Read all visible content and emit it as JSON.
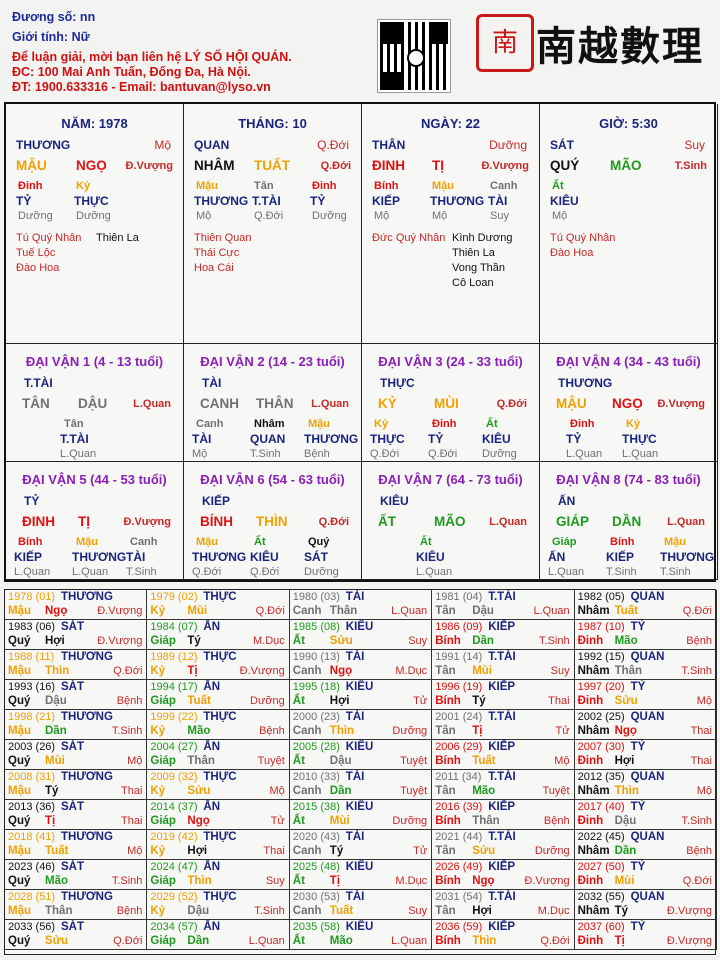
{
  "header": {
    "line1": "Đương số: nn",
    "line2": "Giới tính:  Nữ",
    "line3": "Để luận giải, mời bạn liên hệ LÝ SỐ HỘI QUÁN.",
    "line4": "ĐC: 100 Mai Anh Tuấn, Đống Đa, Hà Nội.",
    "line5": "ĐT: 1900.633316 - Email: bantuvan@lyso.vn",
    "seal_text": "南",
    "brand_text": "南越數理"
  },
  "pillars": [
    {
      "title": "NĂM: 1978",
      "god_left": "THƯƠNG",
      "god_right": "Mộ",
      "stem": "MẬU",
      "branch": "NGỌ",
      "status": "Đ.Vượng",
      "hidden": [
        "Đinh",
        "Kỷ"
      ],
      "hidden_gods": [
        "TỶ",
        "THỰC"
      ],
      "hidden_status": [
        "Dưỡng",
        "Dưỡng"
      ],
      "stars_left": [
        "Tú Quý Nhân",
        "Tuế Lộc",
        "Đào Hoa"
      ],
      "stars_right": [
        "Thiên La"
      ]
    },
    {
      "title": "THÁNG: 10",
      "god_left": "QUAN",
      "god_right": "Q.Đới",
      "stem": "NHÂM",
      "branch": "TUẤT",
      "status": "Q.Đới",
      "hidden": [
        "Mậu",
        "Tân",
        "Đinh"
      ],
      "hidden_gods": [
        "THƯƠNG",
        "T.TÀI",
        "TỶ"
      ],
      "hidden_status": [
        "Mộ",
        "Q.Đới",
        "Dưỡng"
      ],
      "stars_left": [
        "Thiên Quan",
        "Thái Cực",
        "Hoa Cái"
      ],
      "stars_right": []
    },
    {
      "title": "NGÀY: 22",
      "god_left": "THÂN",
      "god_right": "Dưỡng",
      "stem": "ĐINH",
      "branch": "TỊ",
      "status": "Đ.Vượng",
      "hidden": [
        "Bính",
        "Mậu",
        "Canh"
      ],
      "hidden_gods": [
        "KIẾP",
        "THƯƠNG",
        "TÀI"
      ],
      "hidden_status": [
        "Mộ",
        "Mộ",
        "Suy"
      ],
      "stars_left": [
        "Đức Quý Nhân"
      ],
      "stars_right": [
        "Kình Dương",
        "Thiên La",
        "Vong Thần",
        "Cô Loan"
      ]
    },
    {
      "title": "GIỜ: 5:30",
      "god_left": "SÁT",
      "god_right": "Suy",
      "stem": "QUÝ",
      "branch": "MÃO",
      "status": "T.Sinh",
      "hidden": [
        "Ất"
      ],
      "hidden_gods": [
        "KIÊU"
      ],
      "hidden_status": [
        "Mộ"
      ],
      "stars_left": [
        "Tú Quý Nhân",
        "Đào Hoa"
      ],
      "stars_right": []
    }
  ],
  "dai_van": [
    {
      "title": "ĐẠI VẬN 1 (4 - 13 tuổi)",
      "god": "T.TÀI",
      "stem": "TÂN",
      "branch": "DẬU",
      "status": "L.Quan",
      "hidden": [
        "Tân"
      ],
      "hidden_gods": [
        "T.TÀI"
      ],
      "hidden_status": [
        "L.Quan"
      ]
    },
    {
      "title": "ĐẠI VẬN 2 (14 - 23 tuổi)",
      "god": "TÀI",
      "stem": "CANH",
      "branch": "THÂN",
      "status": "L.Quan",
      "hidden": [
        "Canh",
        "Nhâm",
        "Mậu"
      ],
      "hidden_gods": [
        "TÀI",
        "QUAN",
        "THƯƠNG"
      ],
      "hidden_status": [
        "Mộ",
        "T.Sinh",
        "Bệnh"
      ]
    },
    {
      "title": "ĐẠI VẬN 3 (24 - 33 tuổi)",
      "god": "THỰC",
      "stem": "KỶ",
      "branch": "MÙI",
      "status": "Q.Đới",
      "hidden": [
        "Kỷ",
        "Đinh",
        "Ất"
      ],
      "hidden_gods": [
        "THỰC",
        "TỶ",
        "KIÊU"
      ],
      "hidden_status": [
        "Q.Đới",
        "Q.Đới",
        "Dưỡng"
      ]
    },
    {
      "title": "ĐẠI VẬN 4 (34 - 43 tuổi)",
      "god": "THƯƠNG",
      "stem": "MẬU",
      "branch": "NGỌ",
      "status": "Đ.Vượng",
      "hidden": [
        "Đinh",
        "Kỷ"
      ],
      "hidden_gods": [
        "TỶ",
        "THỰC"
      ],
      "hidden_status": [
        "L.Quan",
        "L.Quan"
      ]
    },
    {
      "title": "ĐẠI VẬN 5 (44 - 53 tuổi)",
      "god": "TỶ",
      "stem": "ĐINH",
      "branch": "TỊ",
      "status": "Đ.Vượng",
      "hidden": [
        "Bính",
        "Mậu",
        "Canh"
      ],
      "hidden_gods": [
        "KIẾP",
        "THƯƠNG",
        "TÀI"
      ],
      "hidden_status": [
        "L.Quan",
        "L.Quan",
        "T.Sinh"
      ]
    },
    {
      "title": "ĐẠI VẬN 6 (54 - 63 tuổi)",
      "god": "KIẾP",
      "stem": "BÍNH",
      "branch": "THÌN",
      "status": "Q.Đới",
      "hidden": [
        "Mậu",
        "Ất",
        "Quý"
      ],
      "hidden_gods": [
        "THƯƠNG",
        "KIÊU",
        "SÁT"
      ],
      "hidden_status": [
        "Q.Đới",
        "Q.Đới",
        "Dưỡng"
      ]
    },
    {
      "title": "ĐẠI VẬN 7 (64 - 73 tuổi)",
      "god": "KIÊU",
      "stem": "ẤT",
      "branch": "MÃO",
      "status": "L.Quan",
      "hidden": [
        "Ất"
      ],
      "hidden_gods": [
        "KIÊU"
      ],
      "hidden_status": [
        "L.Quan"
      ]
    },
    {
      "title": "ĐẠI VẬN 8 (74 - 83 tuổi)",
      "god": "ẤN",
      "stem": "GIÁP",
      "branch": "DẦN",
      "status": "L.Quan",
      "hidden": [
        "Giáp",
        "Bính",
        "Mậu"
      ],
      "hidden_gods": [
        "ẤN",
        "KIẾP",
        "THƯƠNG"
      ],
      "hidden_status": [
        "L.Quan",
        "T.Sinh",
        "T.Sinh"
      ]
    }
  ],
  "years": [
    {
      "head": "1978 (01)",
      "god": "THƯƠNG",
      "stem": "Mậu",
      "branch": "Ngọ",
      "status": "Đ.Vượng"
    },
    {
      "head": "1979 (02)",
      "god": "THỰC",
      "stem": "Kỷ",
      "branch": "Mùi",
      "status": "Q.Đới"
    },
    {
      "head": "1980 (03)",
      "god": "TÀI",
      "stem": "Canh",
      "branch": "Thân",
      "status": "L.Quan"
    },
    {
      "head": "1981 (04)",
      "god": "T.TÀI",
      "stem": "Tân",
      "branch": "Dậu",
      "status": "L.Quan"
    },
    {
      "head": "1982 (05)",
      "god": "QUAN",
      "stem": "Nhâm",
      "branch": "Tuất",
      "status": "Q.Đới"
    },
    {
      "head": "1983 (06)",
      "god": "SÁT",
      "stem": "Quý",
      "branch": "Hợi",
      "status": "Đ.Vượng"
    },
    {
      "head": "1984 (07)",
      "god": "ẤN",
      "stem": "Giáp",
      "branch": "Tý",
      "status": "M.Dục"
    },
    {
      "head": "1985 (08)",
      "god": "KIÊU",
      "stem": "Ất",
      "branch": "Sửu",
      "status": "Suy"
    },
    {
      "head": "1986 (09)",
      "god": "KIẾP",
      "stem": "Bính",
      "branch": "Dần",
      "status": "T.Sinh"
    },
    {
      "head": "1987 (10)",
      "god": "TỶ",
      "stem": "Đinh",
      "branch": "Mão",
      "status": "Bệnh"
    },
    {
      "head": "1988 (11)",
      "god": "THƯƠNG",
      "stem": "Mậu",
      "branch": "Thìn",
      "status": "Q.Đới"
    },
    {
      "head": "1989 (12)",
      "god": "THỰC",
      "stem": "Kỷ",
      "branch": "Tị",
      "status": "Đ.Vượng"
    },
    {
      "head": "1990 (13)",
      "god": "TÀI",
      "stem": "Canh",
      "branch": "Ngọ",
      "status": "M.Dục"
    },
    {
      "head": "1991 (14)",
      "god": "T.TÀI",
      "stem": "Tân",
      "branch": "Mùi",
      "status": "Suy"
    },
    {
      "head": "1992 (15)",
      "god": "QUAN",
      "stem": "Nhâm",
      "branch": "Thân",
      "status": "T.Sinh"
    },
    {
      "head": "1993 (16)",
      "god": "SÁT",
      "stem": "Quý",
      "branch": "Dậu",
      "status": "Bệnh"
    },
    {
      "head": "1994 (17)",
      "god": "ẤN",
      "stem": "Giáp",
      "branch": "Tuất",
      "status": "Dưỡng"
    },
    {
      "head": "1995 (18)",
      "god": "KIÊU",
      "stem": "Ất",
      "branch": "Hợi",
      "status": "Tử"
    },
    {
      "head": "1996 (19)",
      "god": "KIẾP",
      "stem": "Bính",
      "branch": "Tý",
      "status": "Thai"
    },
    {
      "head": "1997 (20)",
      "god": "TỶ",
      "stem": "Đinh",
      "branch": "Sửu",
      "status": "Mộ"
    },
    {
      "head": "1998 (21)",
      "god": "THƯƠNG",
      "stem": "Mậu",
      "branch": "Dần",
      "status": "T.Sinh"
    },
    {
      "head": "1999 (22)",
      "god": "THỰC",
      "stem": "Kỷ",
      "branch": "Mão",
      "status": "Bệnh"
    },
    {
      "head": "2000 (23)",
      "god": "TÀI",
      "stem": "Canh",
      "branch": "Thìn",
      "status": "Dưỡng"
    },
    {
      "head": "2001 (24)",
      "god": "T.TÀI",
      "stem": "Tân",
      "branch": "Tị",
      "status": "Tử"
    },
    {
      "head": "2002 (25)",
      "god": "QUAN",
      "stem": "Nhâm",
      "branch": "Ngọ",
      "status": "Thai"
    },
    {
      "head": "2003 (26)",
      "god": "SÁT",
      "stem": "Quý",
      "branch": "Mùi",
      "status": "Mộ"
    },
    {
      "head": "2004 (27)",
      "god": "ẤN",
      "stem": "Giáp",
      "branch": "Thân",
      "status": "Tuyệt"
    },
    {
      "head": "2005 (28)",
      "god": "KIÊU",
      "stem": "Ất",
      "branch": "Dậu",
      "status": "Tuyệt"
    },
    {
      "head": "2006 (29)",
      "god": "KIẾP",
      "stem": "Bính",
      "branch": "Tuất",
      "status": "Mộ"
    },
    {
      "head": "2007 (30)",
      "god": "TỶ",
      "stem": "Đinh",
      "branch": "Hợi",
      "status": "Thai"
    },
    {
      "head": "2008 (31)",
      "god": "THƯƠNG",
      "stem": "Mậu",
      "branch": "Tý",
      "status": "Thai"
    },
    {
      "head": "2009 (32)",
      "god": "THỰC",
      "stem": "Kỷ",
      "branch": "Sửu",
      "status": "Mộ"
    },
    {
      "head": "2010 (33)",
      "god": "TÀI",
      "stem": "Canh",
      "branch": "Dần",
      "status": "Tuyệt"
    },
    {
      "head": "2011 (34)",
      "god": "T.TÀI",
      "stem": "Tân",
      "branch": "Mão",
      "status": "Tuyệt"
    },
    {
      "head": "2012 (35)",
      "god": "QUAN",
      "stem": "Nhâm",
      "branch": "Thìn",
      "status": "Mộ"
    },
    {
      "head": "2013 (36)",
      "god": "SÁT",
      "stem": "Quý",
      "branch": "Tị",
      "status": "Thai"
    },
    {
      "head": "2014 (37)",
      "god": "ẤN",
      "stem": "Giáp",
      "branch": "Ngọ",
      "status": "Tử"
    },
    {
      "head": "2015 (38)",
      "god": "KIÊU",
      "stem": "Ất",
      "branch": "Mùi",
      "status": "Dưỡng"
    },
    {
      "head": "2016 (39)",
      "god": "KIẾP",
      "stem": "Bính",
      "branch": "Thân",
      "status": "Bệnh"
    },
    {
      "head": "2017 (40)",
      "god": "TỶ",
      "stem": "Đinh",
      "branch": "Dậu",
      "status": "T.Sinh"
    },
    {
      "head": "2018 (41)",
      "god": "THƯƠNG",
      "stem": "Mậu",
      "branch": "Tuất",
      "status": "Mộ"
    },
    {
      "head": "2019 (42)",
      "god": "THỰC",
      "stem": "Kỷ",
      "branch": "Hợi",
      "status": "Thai"
    },
    {
      "head": "2020 (43)",
      "god": "TÀI",
      "stem": "Canh",
      "branch": "Tý",
      "status": "Tử"
    },
    {
      "head": "2021 (44)",
      "god": "T.TÀI",
      "stem": "Tân",
      "branch": "Sửu",
      "status": "Dưỡng"
    },
    {
      "head": "2022 (45)",
      "god": "QUAN",
      "stem": "Nhâm",
      "branch": "Dần",
      "status": "Bệnh"
    },
    {
      "head": "2023 (46)",
      "god": "SÁT",
      "stem": "Quý",
      "branch": "Mão",
      "status": "T.Sinh"
    },
    {
      "head": "2024 (47)",
      "god": "ẤN",
      "stem": "Giáp",
      "branch": "Thìn",
      "status": "Suy"
    },
    {
      "head": "2025 (48)",
      "god": "KIÊU",
      "stem": "Ất",
      "branch": "Tị",
      "status": "M.Dục"
    },
    {
      "head": "2026 (49)",
      "god": "KIẾP",
      "stem": "Bính",
      "branch": "Ngọ",
      "status": "Đ.Vượng"
    },
    {
      "head": "2027 (50)",
      "god": "TỶ",
      "stem": "Đinh",
      "branch": "Mùi",
      "status": "Q.Đới"
    },
    {
      "head": "2028 (51)",
      "god": "THƯƠNG",
      "stem": "Mậu",
      "branch": "Thân",
      "status": "Bệnh"
    },
    {
      "head": "2029 (52)",
      "god": "THỰC",
      "stem": "Kỷ",
      "branch": "Dậu",
      "status": "T.Sinh"
    },
    {
      "head": "2030 (53)",
      "god": "TÀI",
      "stem": "Canh",
      "branch": "Tuất",
      "status": "Suy"
    },
    {
      "head": "2031 (54)",
      "god": "T.TÀI",
      "stem": "Tân",
      "branch": "Hợi",
      "status": "M.Dục"
    },
    {
      "head": "2032 (55)",
      "god": "QUAN",
      "stem": "Nhâm",
      "branch": "Tý",
      "status": "Đ.Vượng"
    },
    {
      "head": "2033 (56)",
      "god": "SÁT",
      "stem": "Quý",
      "branch": "Sửu",
      "status": "Q.Đới"
    },
    {
      "head": "2034 (57)",
      "god": "ẤN",
      "stem": "Giáp",
      "branch": "Dần",
      "status": "L.Quan"
    },
    {
      "head": "2035 (58)",
      "god": "KIÊU",
      "stem": "Ất",
      "branch": "Mão",
      "status": "L.Quan"
    },
    {
      "head": "2036 (59)",
      "god": "KIẾP",
      "stem": "Bính",
      "branch": "Thìn",
      "status": "Q.Đới"
    },
    {
      "head": "2037 (60)",
      "god": "TỶ",
      "stem": "Đinh",
      "branch": "Tị",
      "status": "Đ.Vượng"
    }
  ],
  "colors": {
    "title": "#1a237e",
    "wood": "#1e9a1e",
    "fire": "#e01010",
    "earth": "#f0a000",
    "metal": "#707070",
    "water": "#111111",
    "dai_van_title": "#8b1fb8"
  }
}
